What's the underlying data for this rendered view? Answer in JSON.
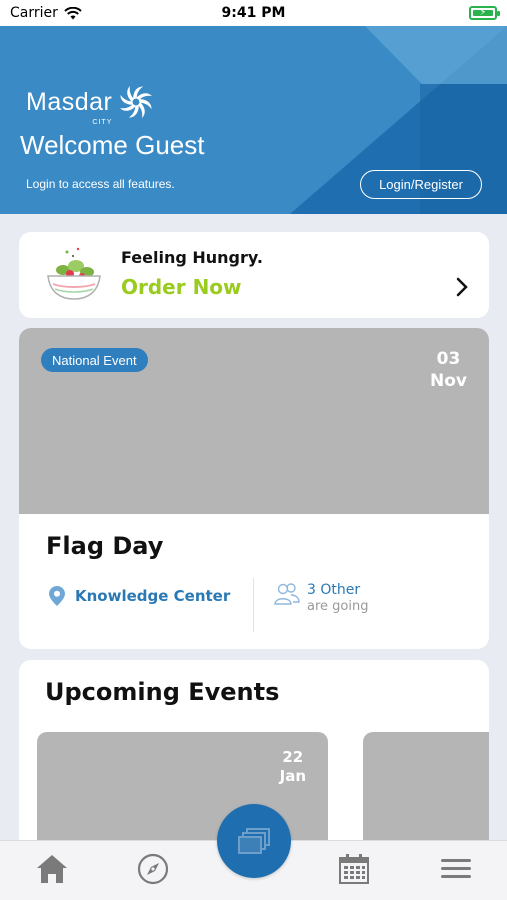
{
  "status_bar": {
    "carrier": "Carrier",
    "time": "9:41 PM"
  },
  "header": {
    "logo_text": "Masdar",
    "logo_sub": "CITY",
    "welcome": "Welcome Guest",
    "login_hint": "Login to access all features.",
    "login_button": "Login/Register"
  },
  "order_card": {
    "title": "Feeling Hungry.",
    "action": "Order Now"
  },
  "featured_event": {
    "badge": "National Event",
    "day": "03",
    "month": "Nov",
    "title": "Flag Day",
    "location": "Knowledge Center",
    "going_count": "3 Other",
    "going_label": "are going"
  },
  "upcoming": {
    "title": "Upcoming Events",
    "events": [
      {
        "day": "22",
        "month": "Jan"
      }
    ]
  },
  "tabbar": {
    "items": [
      "home-icon",
      "compass-icon",
      "gallery-icon",
      "calendar-icon",
      "menu-icon"
    ]
  },
  "colors": {
    "primary": "#1f6fb0",
    "accent_green": "#9acb1f",
    "link_blue": "#2a79b5",
    "placeholder_gray": "#b5b5b5"
  }
}
